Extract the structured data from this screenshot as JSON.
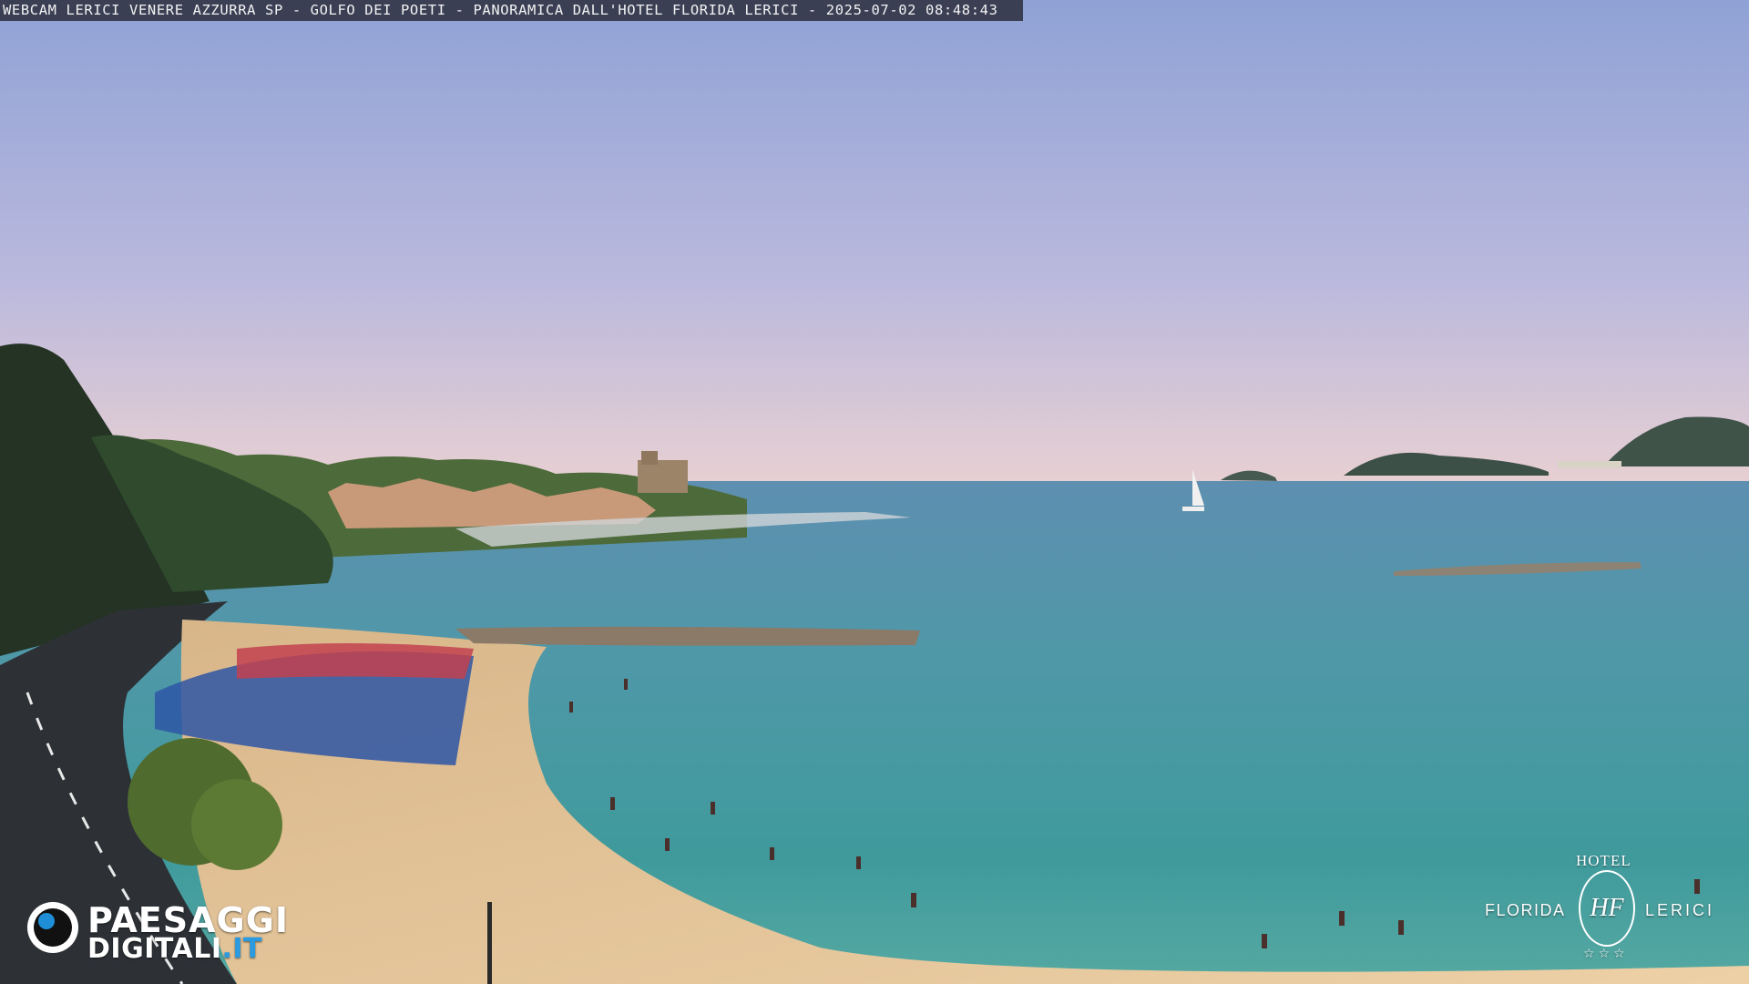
{
  "caption": {
    "text": "WEBCAM LERICI VENERE AZZURRA SP - GOLFO DEI POETI - PANORAMICA DALL'HOTEL FLORIDA LERICI - 2025-07-02 08:48:43"
  },
  "watermark_left": {
    "line1": "PAESAGGI",
    "line2_main": "DIGITALI",
    "line2_accent": ".IT",
    "icon": "eye-icon"
  },
  "watermark_right": {
    "hotel": "HOTEL",
    "word_left": "FLORIDA",
    "word_right": "LERICI",
    "monogram": "HF",
    "stars": "☆☆☆"
  },
  "scene": {
    "sky_top": "#8fa4d6",
    "sky_bottom": "#e9d2d4",
    "sea_far": "#5d8eac",
    "sea_near": "#4aa5a7",
    "sand": "#e7c9a0",
    "hillside": "#223322"
  }
}
